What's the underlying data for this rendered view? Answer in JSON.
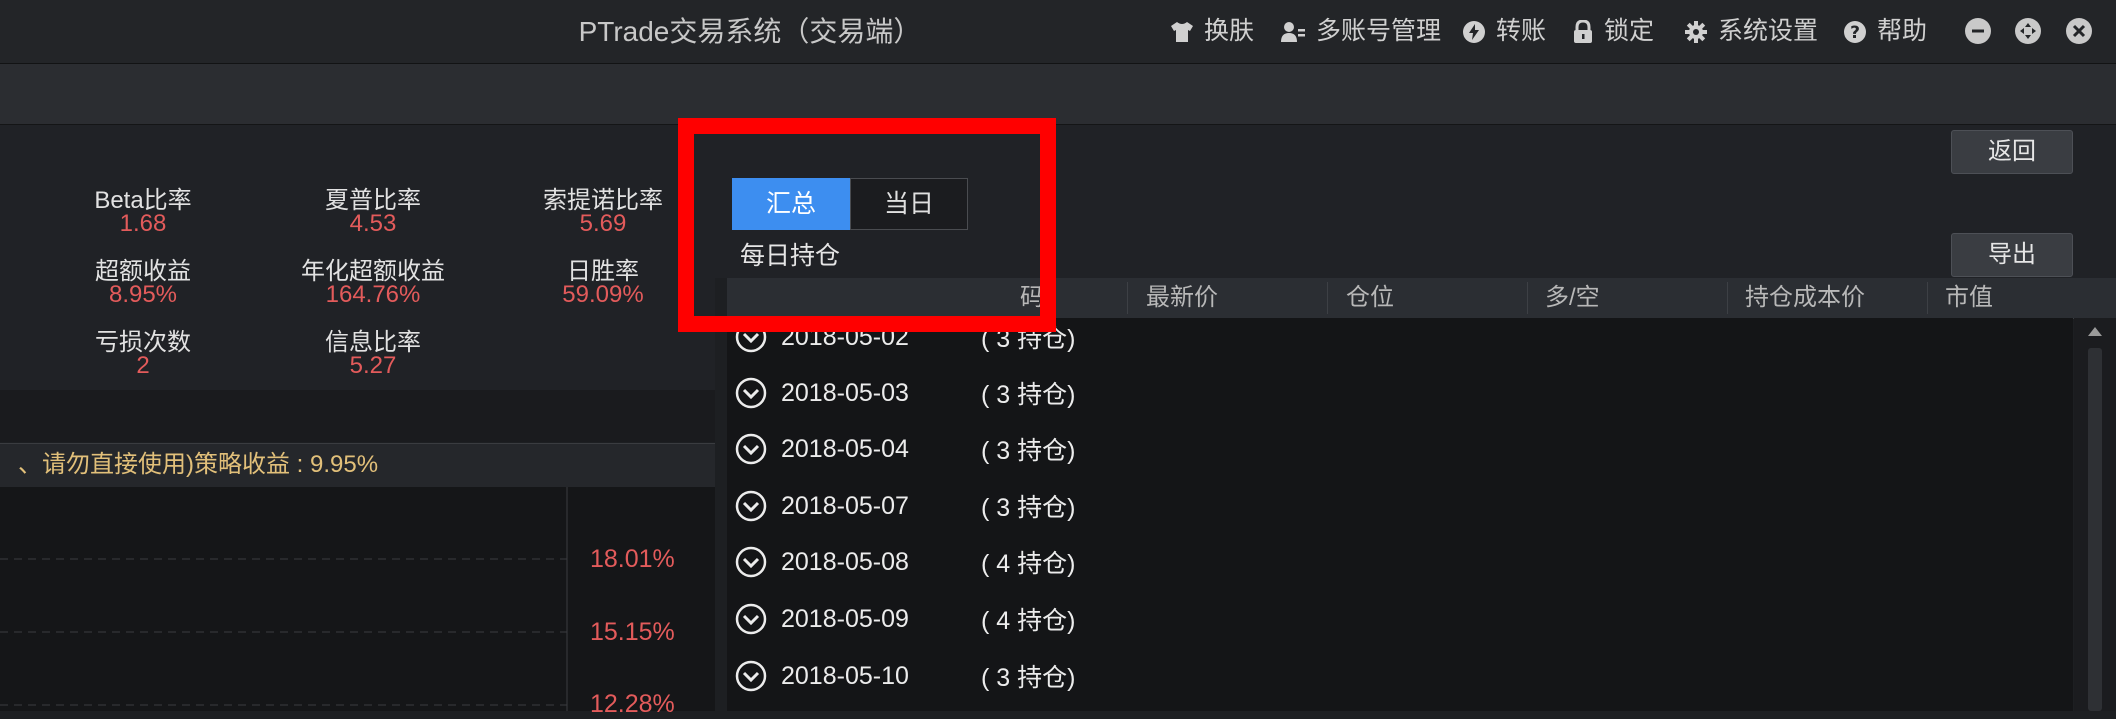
{
  "window": {
    "title": "PTrade交易系统（交易端）",
    "menu": [
      {
        "label": "换肤",
        "icon": "shirt-icon"
      },
      {
        "label": "多账号管理",
        "icon": "user-manage-icon"
      },
      {
        "label": "转账",
        "icon": "lightning-icon"
      },
      {
        "label": "锁定",
        "icon": "lock-icon"
      },
      {
        "label": "系统设置",
        "icon": "gear-icon"
      },
      {
        "label": "帮助",
        "icon": "help-icon"
      }
    ]
  },
  "buttons": {
    "back": "返回",
    "export": "导出"
  },
  "metrics": [
    {
      "label": "Beta比率",
      "value": "1.68"
    },
    {
      "label": "夏普比率",
      "value": "4.53"
    },
    {
      "label": "索提诺比率",
      "value": "5.69"
    },
    {
      "label": "超额收益",
      "value": "8.95%"
    },
    {
      "label": "年化超额收益",
      "value": "164.76%"
    },
    {
      "label": "日胜率",
      "value": "59.09%"
    },
    {
      "label": "亏损次数",
      "value": "2"
    },
    {
      "label": "信息比率",
      "value": "5.27"
    }
  ],
  "strategy_banner": "、请勿直接使用)策略收益 : 9.95%",
  "chart_axis_labels": [
    "18.01%",
    "15.15%",
    "12.28%"
  ],
  "tabs": {
    "summary": "汇总",
    "today": "当日"
  },
  "daily_positions_label": "每日持仓",
  "table": {
    "columns": [
      "码",
      "最新价",
      "仓位",
      "多/空",
      "持仓成本价",
      "市值"
    ],
    "rows": [
      {
        "date": "2018-05-02",
        "count": "( 3 持仓)"
      },
      {
        "date": "2018-05-03",
        "count": "( 3 持仓)"
      },
      {
        "date": "2018-05-04",
        "count": "( 3 持仓)"
      },
      {
        "date": "2018-05-07",
        "count": "( 3 持仓)"
      },
      {
        "date": "2018-05-08",
        "count": "( 4 持仓)"
      },
      {
        "date": "2018-05-09",
        "count": "( 4 持仓)"
      },
      {
        "date": "2018-05-10",
        "count": "( 3 持仓)"
      }
    ]
  },
  "colors": {
    "accent": "#3d8ef0",
    "positive": "#e35b5b",
    "highlight": "#ff0000"
  }
}
